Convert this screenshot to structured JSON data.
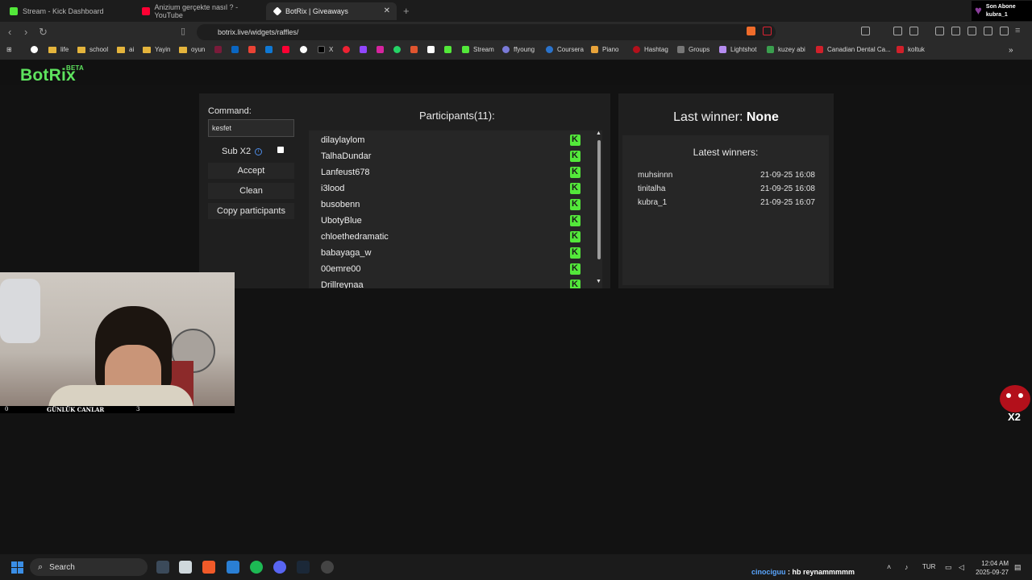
{
  "browser": {
    "tabs": [
      {
        "title": "Stream - Kick Dashboard",
        "favicon_color": "#53e83a"
      },
      {
        "title": "Anizium gerçekte nasıl ? - YouTube",
        "favicon_color": "#ff0033"
      },
      {
        "title": "BotRix | Giveaways",
        "favicon_color": "#ffffff"
      }
    ],
    "url": "botrix.live/widgets/raffles/",
    "profile": {
      "line1": "Son Abone",
      "line2": "kubra_1"
    },
    "bookmarks": [
      "life",
      "school",
      "ai",
      "Yayin",
      "oyun",
      "X",
      "Stream",
      "ffyoung",
      "Coursera",
      "Piano",
      "Hashtag",
      "Groups",
      "Lightshot",
      "kuzey abi",
      "Canadian Dental Ca...",
      "koltuk"
    ]
  },
  "site": {
    "logo": "BotRix",
    "logo_badge": "BETA",
    "brand_color": "#5ee35e"
  },
  "raffle": {
    "command_label": "Command:",
    "command_value": "kesfet",
    "sub_x2_label": "Sub X2",
    "sub_x2_checked": false,
    "buttons": {
      "accept": "Accept",
      "clean": "Clean",
      "copy": "Copy participants"
    },
    "participants_title": "Participants(11):",
    "participants": [
      "dilaylaylom",
      "TalhaDundar",
      "Lanfeust678",
      "i3lood",
      "busobenn",
      "UbotyBlue",
      "chloethedramatic",
      "babayaga_w",
      "00emre00",
      "Drillreynaa"
    ]
  },
  "winners": {
    "last_winner_label": "Last winner:",
    "last_winner_value": "None",
    "latest_title": "Latest winners:",
    "latest": [
      {
        "name": "muhsinnn",
        "date": "21-09-25 16:08"
      },
      {
        "name": "tinitalha",
        "date": "21-09-25 16:08"
      },
      {
        "name": "kubra_1",
        "date": "21-09-25 16:07"
      }
    ]
  },
  "webcam": {
    "caption_left": "0",
    "caption_center": "GÜNLÜK CANLAR",
    "caption_right": "3"
  },
  "overlay": {
    "badge": "X2"
  },
  "taskbar": {
    "search_label": "Search",
    "ticker_user": "cinociguu",
    "ticker_msg": ": hb reynammmmm",
    "language": "TUR",
    "time": "12:04 AM",
    "date": "2025-09-27"
  }
}
